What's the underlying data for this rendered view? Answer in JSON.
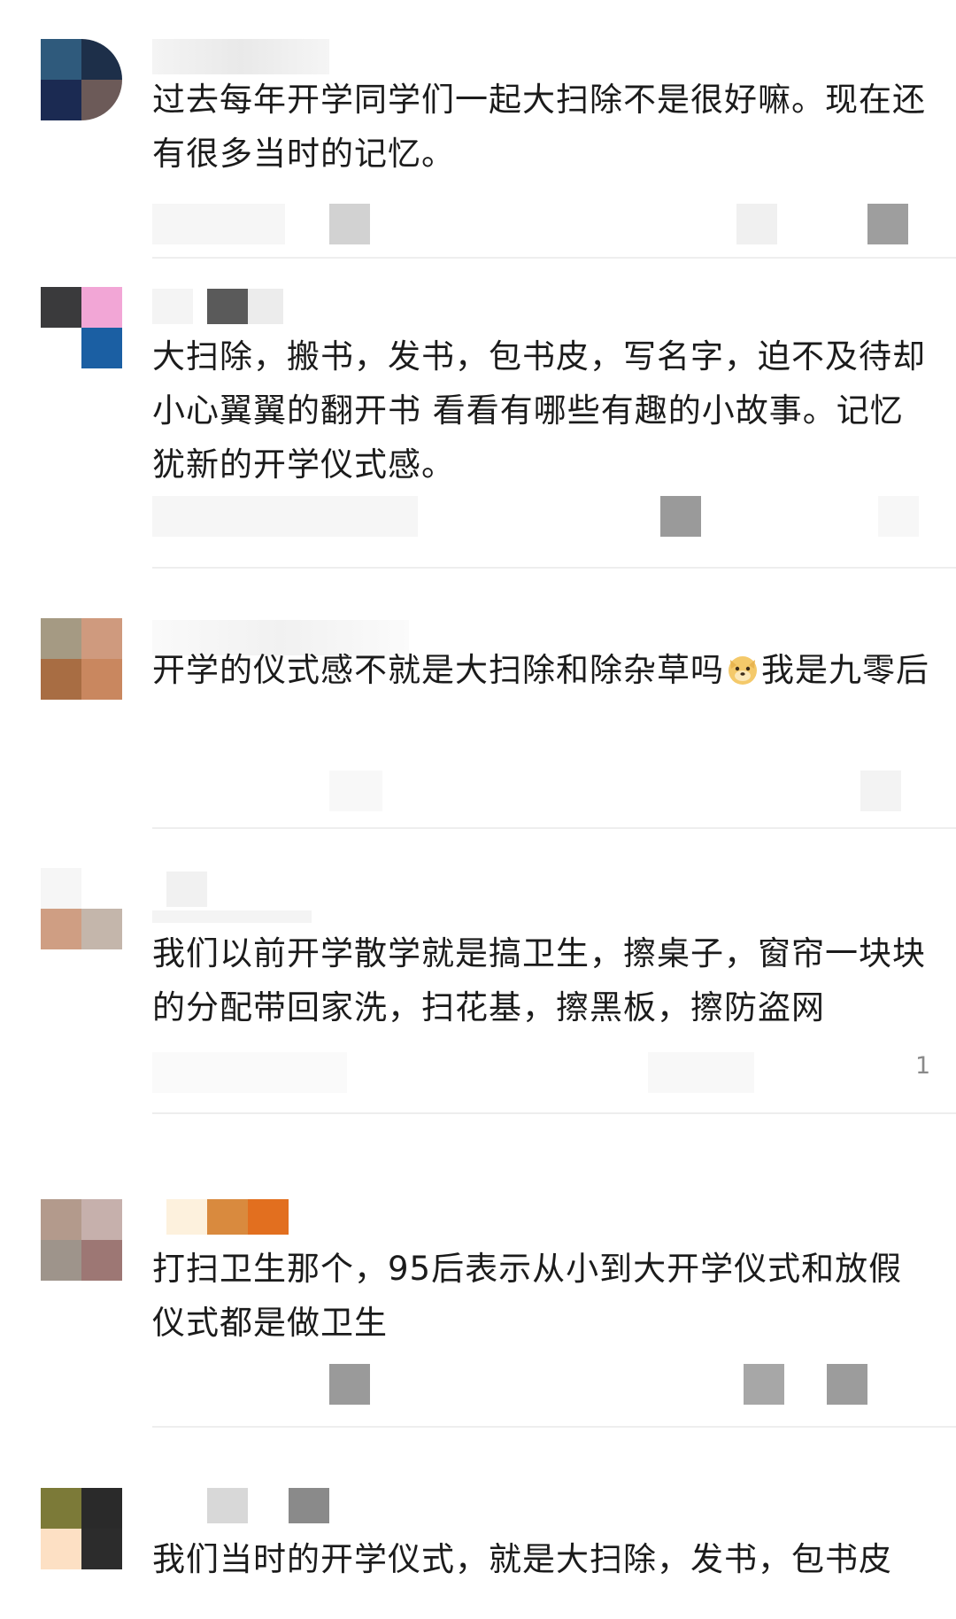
{
  "comments": [
    {
      "text": "过去每年开学同学们一起大扫除不是很好嘛。现在还有很多当时的记忆。",
      "avatar_colors": [
        "#2f5a7c",
        "#1d2f49",
        "#1b2a52",
        "#6c5a58"
      ]
    },
    {
      "text": "大扫除，搬书，发书，包书皮，写名字，迫不及待却小心翼翼的翻开书  看看有哪些有趣的小故事。记忆犹新的开学仪式感。",
      "avatar_colors": [
        "#3a3a3c",
        "#f2a6d6",
        "#ffffff",
        "#1b5fa3"
      ]
    },
    {
      "text_before_emoji": "开学的仪式感不就是大扫除和除杂草吗",
      "emoji": "doge-emoji",
      "text_after_emoji": "我是九零后",
      "avatar_colors": [
        "#a59a83",
        "#cf9a7e",
        "#a86d43",
        "#c9875f"
      ]
    },
    {
      "text": "我们以前开学散学就是搞卫生，擦桌子，窗帘一块块的分配带回家洗，扫花基，擦黑板，擦防盗网",
      "count": "1",
      "avatar_colors": [
        "#cf9e83",
        "#c4b6ab",
        "#ffffff",
        "#f7f2ee"
      ]
    },
    {
      "text": "打扫卫生那个，95后表示从小到大开学仪式和放假仪式都是做卫生",
      "avatar_colors": [
        "#b39a8c",
        "#c6b0ac",
        "#9e948b",
        "#9d7774"
      ]
    },
    {
      "text": "我们当时的开学仪式，就是大扫除，发书，包书皮",
      "avatar_colors": [
        "#7c7a38",
        "#2a2a2a",
        "#fde0c4",
        "#2c2c2c"
      ]
    }
  ],
  "colors": {
    "text": "#1b1b1b",
    "divider": "#eeeeee",
    "meta_gray": "#8a8a8a"
  }
}
